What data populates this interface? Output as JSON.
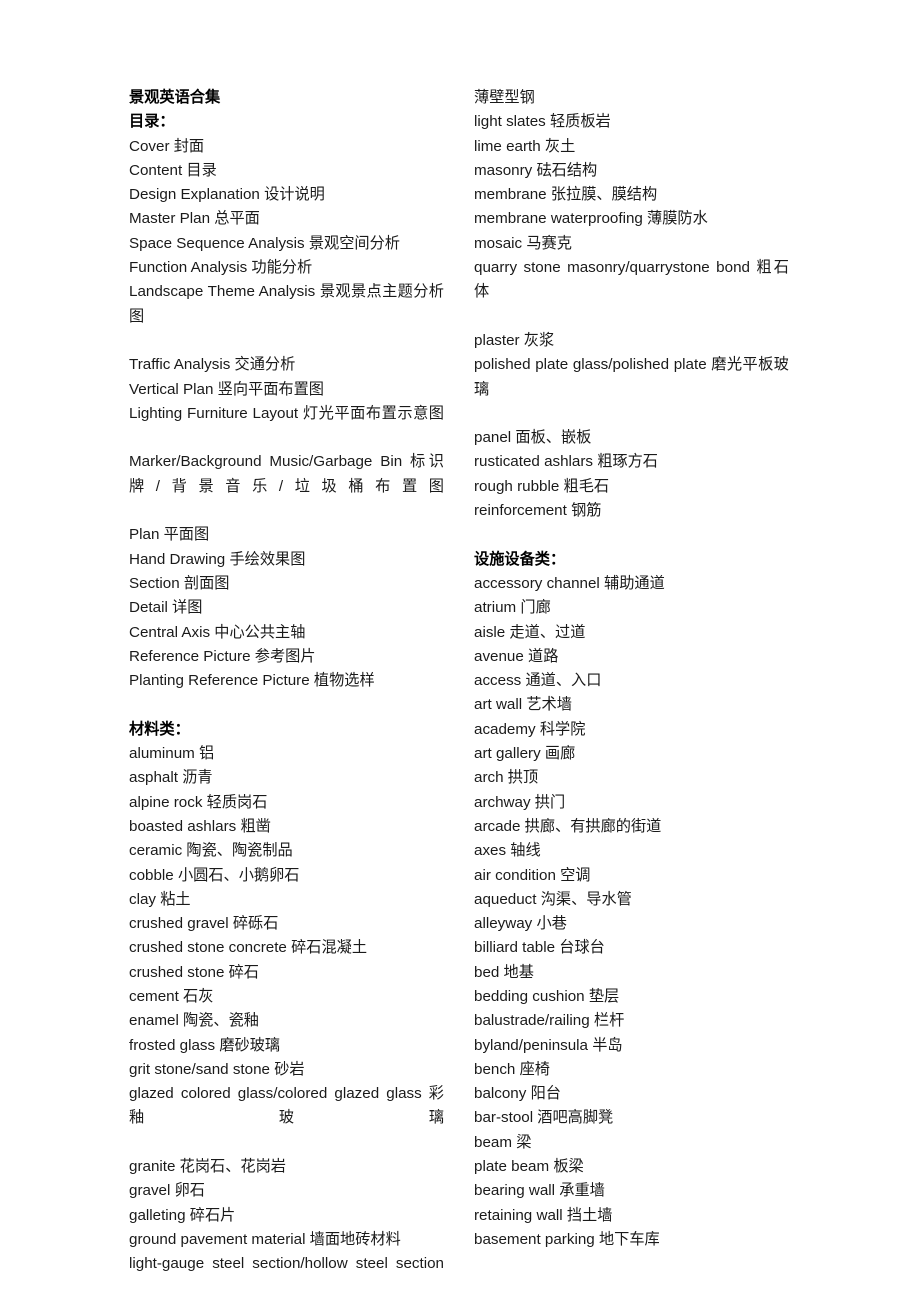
{
  "document": {
    "title": "景观英语合集",
    "left_column": [
      {
        "text": "景观英语合集",
        "style": "bold"
      },
      {
        "text": "目录：",
        "style": "bold"
      },
      {
        "text": "Cover 封面",
        "style": "normal"
      },
      {
        "text": "Content 目录",
        "style": "normal"
      },
      {
        "text": "Design Explanation 设计说明",
        "style": "normal"
      },
      {
        "text": "Master Plan 总平面",
        "style": "normal"
      },
      {
        "text": "Space Sequence Analysis 景观空间分析",
        "style": "normal"
      },
      {
        "text": "Function Analysis 功能分析",
        "style": "normal"
      },
      {
        "text": "Landscape Theme Analysis 景观景点主题分析图",
        "style": "justify"
      },
      {
        "text": "Traffic Analysis 交通分析",
        "style": "normal"
      },
      {
        "text": "Vertical Plan 竖向平面布置图",
        "style": "normal"
      },
      {
        "text": "Lighting Furniture Layout 灯光平面布置示意图",
        "style": "justify"
      },
      {
        "text": "Marker/Background Music/Garbage Bin 标识牌/背景音乐/垃圾桶布置图",
        "style": "justify"
      },
      {
        "text": "Plan 平面图",
        "style": "normal"
      },
      {
        "text": "Hand Drawing 手绘效果图",
        "style": "normal"
      },
      {
        "text": "Section 剖面图",
        "style": "normal"
      },
      {
        "text": "Detail 详图",
        "style": "normal"
      },
      {
        "text": "Central Axis 中心公共主轴",
        "style": "normal"
      },
      {
        "text": "Reference Picture 参考图片",
        "style": "normal"
      },
      {
        "text": "Planting Reference Picture 植物选样",
        "style": "normal"
      },
      {
        "text": "",
        "style": "spacer"
      },
      {
        "text": "材料类：",
        "style": "bold"
      },
      {
        "text": "aluminum 铝",
        "style": "normal"
      },
      {
        "text": "asphalt 沥青",
        "style": "normal"
      },
      {
        "text": "alpine rock 轻质岗石",
        "style": "normal"
      },
      {
        "text": "boasted ashlars 粗凿",
        "style": "normal"
      },
      {
        "text": "ceramic 陶瓷、陶瓷制品",
        "style": "normal"
      },
      {
        "text": "cobble 小圆石、小鹅卵石",
        "style": "normal"
      },
      {
        "text": "clay 粘土",
        "style": "normal"
      },
      {
        "text": "crushed gravel 碎砾石",
        "style": "normal"
      },
      {
        "text": "crushed stone concrete 碎石混凝土",
        "style": "normal"
      },
      {
        "text": "crushed stone 碎石",
        "style": "normal"
      },
      {
        "text": "cement 石灰",
        "style": "normal"
      },
      {
        "text": "enamel 陶瓷、瓷釉",
        "style": "normal"
      },
      {
        "text": "frosted glass 磨砂玻璃",
        "style": "normal"
      },
      {
        "text": "grit stone/sand stone 砂岩",
        "style": "normal"
      },
      {
        "text": "glazed colored glass/colored glazed glass 彩釉玻璃",
        "style": "justify"
      },
      {
        "text": "granite 花岗石、花岗岩",
        "style": "normal"
      },
      {
        "text": "gravel 卵石",
        "style": "normal"
      },
      {
        "text": "galleting 碎石片",
        "style": "normal"
      },
      {
        "text": "ground pavement material 墙面地砖材料",
        "style": "normal"
      },
      {
        "text": "light-gauge steel section/hollow steel section",
        "style": "justify-last"
      }
    ],
    "right_column": [
      {
        "text": "薄壁型钢",
        "style": "normal"
      },
      {
        "text": "light slates 轻质板岩",
        "style": "normal"
      },
      {
        "text": "lime earth 灰土",
        "style": "normal"
      },
      {
        "text": "masonry 砝石结构",
        "style": "normal"
      },
      {
        "text": "membrane 张拉膜、膜结构",
        "style": "normal"
      },
      {
        "text": "membrane waterproofing 薄膜防水",
        "style": "normal"
      },
      {
        "text": "mosaic 马赛克",
        "style": "normal"
      },
      {
        "text": "quarry stone masonry/quarrystone bond 粗石体",
        "style": "justify"
      },
      {
        "text": "plaster 灰浆",
        "style": "normal"
      },
      {
        "text": "polished plate glass/polished plate 磨光平板玻璃",
        "style": "justify"
      },
      {
        "text": "panel 面板、嵌板",
        "style": "normal"
      },
      {
        "text": "rusticated ashlars 粗琢方石",
        "style": "normal"
      },
      {
        "text": "rough rubble 粗毛石",
        "style": "normal"
      },
      {
        "text": "reinforcement 钢筋",
        "style": "normal"
      },
      {
        "text": "",
        "style": "spacer"
      },
      {
        "text": "设施设备类：",
        "style": "bold"
      },
      {
        "text": "accessory channel 辅助通道",
        "style": "normal"
      },
      {
        "text": "atrium 门廊",
        "style": "normal"
      },
      {
        "text": "aisle 走道、过道",
        "style": "normal"
      },
      {
        "text": "avenue 道路",
        "style": "normal"
      },
      {
        "text": "access 通道、入口",
        "style": "normal"
      },
      {
        "text": "art wall 艺术墙",
        "style": "normal"
      },
      {
        "text": "academy 科学院",
        "style": "normal"
      },
      {
        "text": "art gallery 画廊",
        "style": "normal"
      },
      {
        "text": "arch 拱顶",
        "style": "normal"
      },
      {
        "text": "archway 拱门",
        "style": "normal"
      },
      {
        "text": "arcade 拱廊、有拱廊的街道",
        "style": "normal"
      },
      {
        "text": "axes 轴线",
        "style": "normal"
      },
      {
        "text": "air condition 空调",
        "style": "normal"
      },
      {
        "text": "aqueduct 沟渠、导水管",
        "style": "normal"
      },
      {
        "text": "alleyway 小巷",
        "style": "normal"
      },
      {
        "text": "billiard table 台球台",
        "style": "normal"
      },
      {
        "text": "bed 地基",
        "style": "normal"
      },
      {
        "text": "bedding cushion 垫层",
        "style": "normal"
      },
      {
        "text": "balustrade/railing 栏杆",
        "style": "normal"
      },
      {
        "text": "byland/peninsula 半岛",
        "style": "normal"
      },
      {
        "text": "bench 座椅",
        "style": "normal"
      },
      {
        "text": "balcony 阳台",
        "style": "normal"
      },
      {
        "text": "bar-stool 酒吧高脚凳",
        "style": "normal"
      },
      {
        "text": "beam 梁",
        "style": "normal"
      },
      {
        "text": "plate beam 板梁",
        "style": "normal"
      },
      {
        "text": "bearing wall 承重墙",
        "style": "normal"
      },
      {
        "text": "retaining wall 挡土墙",
        "style": "normal"
      },
      {
        "text": "basement parking 地下车库",
        "style": "normal"
      }
    ]
  }
}
